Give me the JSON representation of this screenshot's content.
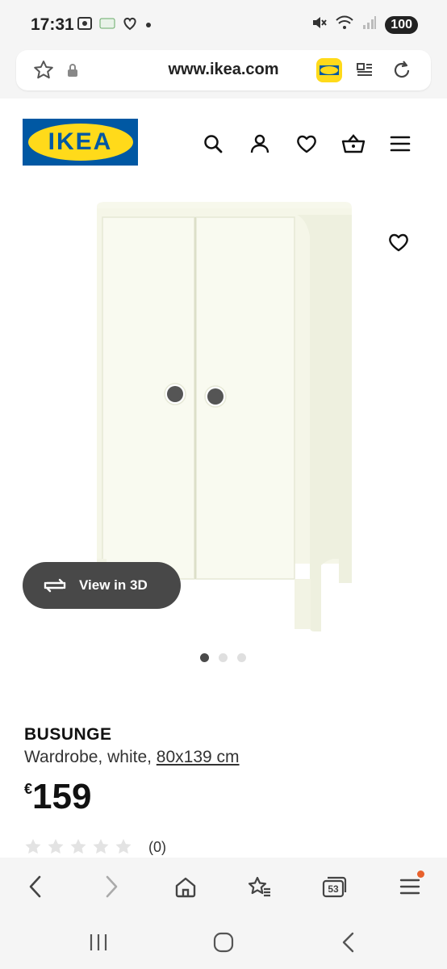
{
  "status_bar": {
    "time": "17:31",
    "battery": "100",
    "left_icons": [
      "screenshot-icon",
      "app-icon",
      "heart-shield-icon",
      "dot-icon"
    ],
    "right_icons": [
      "mute-icon",
      "wifi-icon",
      "signal-icon"
    ]
  },
  "browser": {
    "url": "www.ikea.com",
    "tab_count": "53"
  },
  "site": {
    "logo_text": "IKEA",
    "brand_blue": "#0058a3",
    "brand_yellow": "#ffda1a"
  },
  "gallery": {
    "view_3d_label": "View in 3D",
    "image_count": 3,
    "active_index": 0
  },
  "product": {
    "name": "BUSUNGE",
    "description": "Wardrobe, white, ",
    "size": "80x139 cm",
    "currency": "€",
    "price": "159",
    "rating_stars": 0,
    "rating_count": "(0)"
  }
}
